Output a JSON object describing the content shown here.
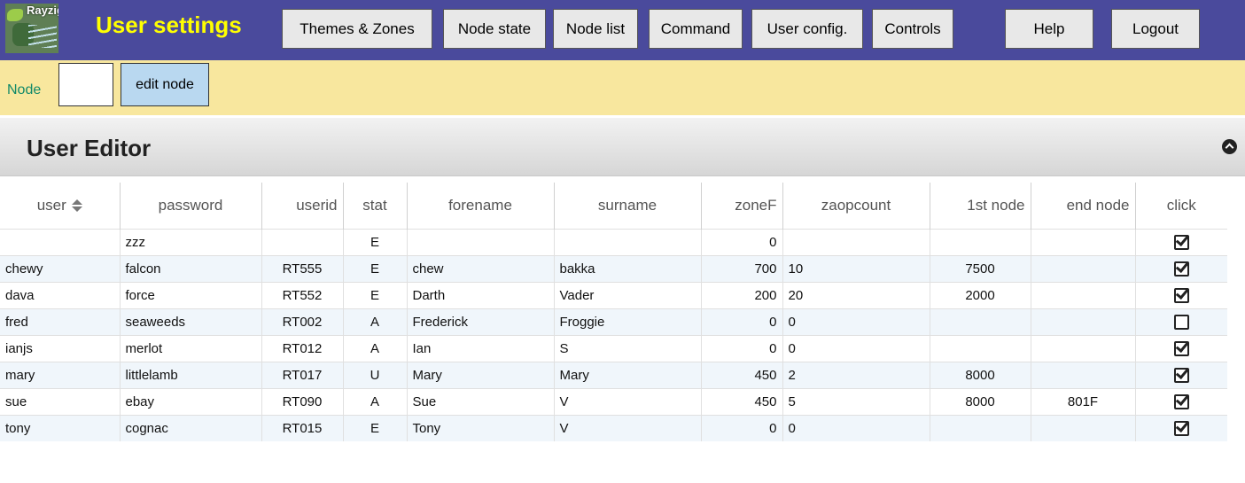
{
  "app": {
    "logo_text": "Rayzig",
    "title": "User settings"
  },
  "nav": [
    {
      "label": "Themes & Zones"
    },
    {
      "label": "Node state"
    },
    {
      "label": "Node list"
    },
    {
      "label": "Command"
    },
    {
      "label": "User config."
    },
    {
      "label": "Controls"
    },
    {
      "label": "Help"
    },
    {
      "label": "Logout"
    }
  ],
  "nodebar": {
    "label": "Node",
    "input_value": "",
    "button_label": "edit node"
  },
  "panel": {
    "title": "User Editor"
  },
  "table": {
    "columns": [
      "user",
      "password",
      "userid",
      "stat",
      "forename",
      "surname",
      "zoneF",
      "zaopcount",
      "1st node",
      "end node",
      "click"
    ],
    "sorted_column": "user",
    "rows": [
      {
        "user": "",
        "password": "zzz",
        "userid": "",
        "stat": "E",
        "forename": "",
        "surname": "",
        "zoneF": "0",
        "zaopcount": "",
        "first_node": "",
        "end_node": "",
        "click": true
      },
      {
        "user": "chewy",
        "password": "falcon",
        "userid": "RT555",
        "stat": "E",
        "forename": "chew",
        "surname": "bakka",
        "zoneF": "700",
        "zaopcount": "10",
        "first_node": "7500",
        "end_node": "",
        "click": true
      },
      {
        "user": "dava",
        "password": "force",
        "userid": "RT552",
        "stat": "E",
        "forename": "Darth",
        "surname": "Vader",
        "zoneF": "200",
        "zaopcount": "20",
        "first_node": "2000",
        "end_node": "",
        "click": true
      },
      {
        "user": "fred",
        "password": "seaweeds",
        "userid": "RT002",
        "stat": "A",
        "forename": "Frederick",
        "surname": "Froggie",
        "zoneF": "0",
        "zaopcount": "0",
        "first_node": "",
        "end_node": "",
        "click": false
      },
      {
        "user": "ianjs",
        "password": "merlot",
        "userid": "RT012",
        "stat": "A",
        "forename": "Ian",
        "surname": "S",
        "zoneF": "0",
        "zaopcount": "0",
        "first_node": "",
        "end_node": "",
        "click": true
      },
      {
        "user": "mary",
        "password": "littlelamb",
        "userid": "RT017",
        "stat": "U",
        "forename": "Mary",
        "surname": "Mary",
        "zoneF": "450",
        "zaopcount": "2",
        "first_node": "8000",
        "end_node": "",
        "click": true
      },
      {
        "user": "sue",
        "password": "ebay",
        "userid": "RT090",
        "stat": "A",
        "forename": "Sue",
        "surname": "V",
        "zoneF": "450",
        "zaopcount": "5",
        "first_node": "8000",
        "end_node": "801F",
        "click": true
      },
      {
        "user": "tony",
        "password": "cognac",
        "userid": "RT015",
        "stat": "E",
        "forename": "Tony",
        "surname": "V",
        "zoneF": "0",
        "zaopcount": "0",
        "first_node": "",
        "end_node": "",
        "click": true
      }
    ]
  },
  "colors": {
    "nav_bar": "#4a4a9c",
    "title_text": "#ffff00",
    "node_bar": "#f8e79e",
    "node_label": "#138a69",
    "edit_button": "#b9d8f0",
    "row_alt": "#f0f6fb"
  },
  "icons": {
    "sort": "sort-both-icon",
    "collapse": "circle-chevron-up-icon",
    "checkbox_checked": "checkbox-checked-icon",
    "checkbox_empty": "checkbox-empty-icon"
  }
}
